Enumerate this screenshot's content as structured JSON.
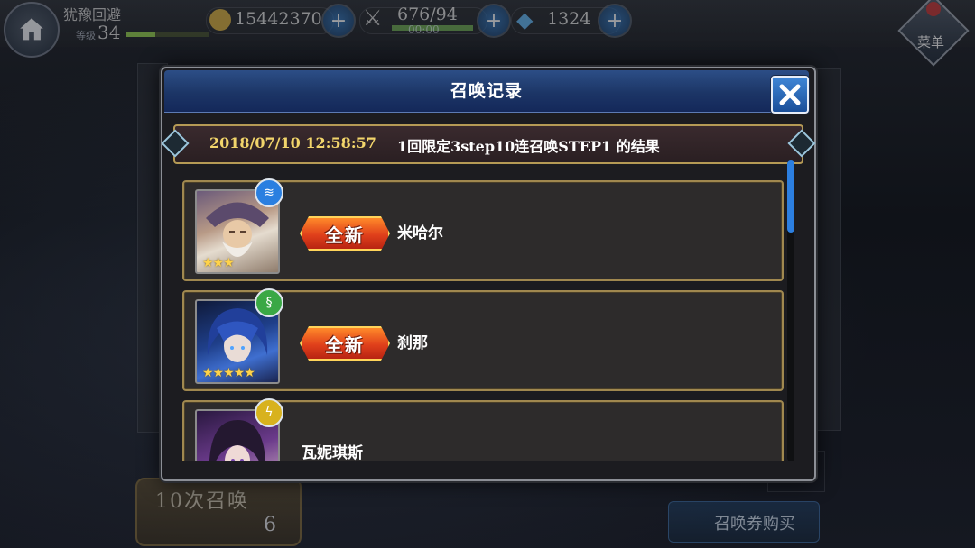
{
  "hud": {
    "player_name": "犹豫回避",
    "level_label": "等级",
    "level": "34",
    "level_progress": 0.35,
    "gold": "15442370",
    "stamina": "676/94",
    "stamina_timer": "00:00",
    "gems": "1324",
    "menu_label": "菜单",
    "add_symbol": "+"
  },
  "background": {
    "summon_button_label": "10次召唤",
    "summon_button_count": "6",
    "ticket_button_label": "召唤券购买"
  },
  "modal": {
    "title": "召唤记录",
    "close_icon": "close-x-icon",
    "result_time": "2018/07/10 12:58:57",
    "result_desc": "1回限定3step10连召唤STEP1 的结果",
    "results": [
      {
        "name": "米哈尔",
        "new_label": "全新",
        "stars": "★★★",
        "element": "water",
        "element_glyph": "≋",
        "element_color": "#2a7fe0"
      },
      {
        "name": "刹那",
        "new_label": "全新",
        "stars": "★★★★★",
        "element": "wind",
        "element_glyph": "§",
        "element_color": "#3aa845"
      },
      {
        "name": "瓦妮琪斯",
        "new_label": "",
        "stars": "",
        "element": "lightning",
        "element_glyph": "ϟ",
        "element_color": "#d8b21e"
      }
    ]
  },
  "colors": {
    "header_blue": "#1c3566",
    "banner_gold": "#b59a55",
    "time_yellow": "#f2d56b",
    "scroll_blue": "#2c7fe0"
  }
}
